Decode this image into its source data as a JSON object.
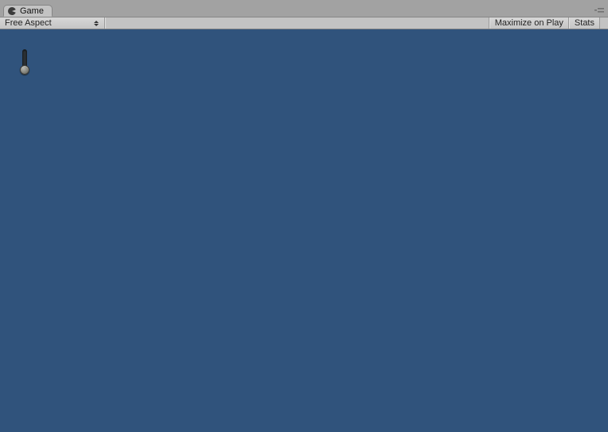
{
  "tab": {
    "label": "Game",
    "icon": "pacman-icon"
  },
  "toolbar": {
    "aspect": {
      "selected": "Free Aspect"
    },
    "maximize_on_play": "Maximize on Play",
    "stats": "Stats"
  },
  "viewport": {
    "background": "#30537c",
    "slider": {
      "value_position": "bottom"
    }
  }
}
